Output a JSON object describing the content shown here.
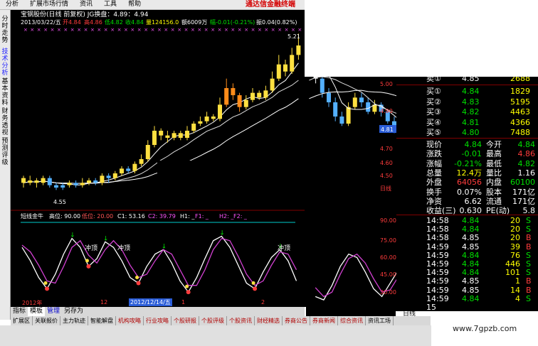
{
  "menu": [
    "分析",
    "扩展市场行情",
    "资讯",
    "工具",
    "帮助"
  ],
  "brand": "通达信金融终端",
  "left_tabs": [
    {
      "label": "分时走势",
      "active": false
    },
    {
      "label": "技术分析",
      "active": true
    },
    {
      "label": "基本资料",
      "active": false
    },
    {
      "label": "财务透视",
      "active": false
    },
    {
      "label": "预测评级",
      "active": false
    }
  ],
  "chart_header": {
    "line1": "宝钢股份(日线 前复权) JG换盘：4.89：4.94",
    "date": "2013/03/22/五",
    "open": "开4.84",
    "high": "高4.86",
    "low": "低4.82",
    "close": "收4.84",
    "vol": "量124156.0",
    "amount": "额6009万",
    "change": "幅-0.01(-0.21%)",
    "amp": "振0.04(0.82%)"
  },
  "main_labels": {
    "max": "5.21",
    "min": "4.55",
    "current": "4.81",
    "price_axis": [
      "5.00",
      "4.90",
      "4.80",
      "4.70",
      "4.60",
      "4.50"
    ],
    "day_label": "日线"
  },
  "chart_data": [
    {
      "type": "candlestick",
      "title": "宝钢股份(日线 前复权)",
      "y_axis_labels": [
        "5.00",
        "4.90",
        "4.80",
        "4.70",
        "4.60",
        "4.50"
      ],
      "annotations": [
        "5.21",
        "4.55",
        "4.81"
      ],
      "candles": [
        {
          "o": 4.6,
          "c": 4.58,
          "h": 4.61,
          "l": 4.56,
          "col": "y"
        },
        {
          "o": 4.58,
          "c": 4.59,
          "h": 4.61,
          "l": 4.57,
          "col": "y"
        },
        {
          "o": 4.59,
          "c": 4.58,
          "h": 4.6,
          "l": 4.56,
          "col": "y"
        },
        {
          "o": 4.58,
          "c": 4.6,
          "h": 4.61,
          "l": 4.57,
          "col": "y"
        },
        {
          "o": 4.6,
          "c": 4.57,
          "h": 4.61,
          "l": 4.56,
          "col": "b"
        },
        {
          "o": 4.57,
          "c": 4.56,
          "h": 4.58,
          "l": 4.55,
          "col": "b"
        },
        {
          "o": 4.56,
          "c": 4.57,
          "h": 4.58,
          "l": 4.55,
          "col": "b"
        },
        {
          "o": 4.57,
          "c": 4.58,
          "h": 4.59,
          "l": 4.56,
          "col": "y"
        },
        {
          "o": 4.58,
          "c": 4.57,
          "h": 4.59,
          "l": 4.56,
          "col": "b"
        },
        {
          "o": 4.57,
          "c": 4.58,
          "h": 4.6,
          "l": 4.56,
          "col": "y"
        },
        {
          "o": 4.58,
          "c": 4.59,
          "h": 4.6,
          "l": 4.57,
          "col": "y"
        },
        {
          "o": 4.59,
          "c": 4.58,
          "h": 4.6,
          "l": 4.57,
          "col": "b"
        },
        {
          "o": 4.58,
          "c": 4.61,
          "h": 4.62,
          "l": 4.57,
          "col": "y"
        },
        {
          "o": 4.61,
          "c": 4.6,
          "h": 4.62,
          "l": 4.58,
          "col": "b"
        },
        {
          "o": 4.6,
          "c": 4.62,
          "h": 4.63,
          "l": 4.59,
          "col": "y"
        },
        {
          "o": 4.62,
          "c": 4.64,
          "h": 4.65,
          "l": 4.61,
          "col": "y"
        },
        {
          "o": 4.64,
          "c": 4.63,
          "h": 4.65,
          "l": 4.62,
          "col": "b"
        },
        {
          "o": 4.63,
          "c": 4.66,
          "h": 4.67,
          "l": 4.62,
          "col": "y"
        },
        {
          "o": 4.66,
          "c": 4.68,
          "h": 4.7,
          "l": 4.65,
          "col": "y"
        },
        {
          "o": 4.68,
          "c": 4.74,
          "h": 4.76,
          "l": 4.67,
          "col": "y"
        },
        {
          "o": 4.74,
          "c": 4.8,
          "h": 4.82,
          "l": 4.73,
          "col": "y"
        },
        {
          "o": 4.8,
          "c": 4.78,
          "h": 4.81,
          "l": 4.76,
          "col": "y"
        },
        {
          "o": 4.78,
          "c": 4.77,
          "h": 4.8,
          "l": 4.75,
          "col": "y"
        },
        {
          "o": 4.77,
          "c": 4.79,
          "h": 4.8,
          "l": 4.76,
          "col": "y"
        },
        {
          "o": 4.79,
          "c": 4.77,
          "h": 4.8,
          "l": 4.76,
          "col": "y"
        },
        {
          "o": 4.77,
          "c": 4.8,
          "h": 4.82,
          "l": 4.76,
          "col": "y"
        },
        {
          "o": 4.8,
          "c": 4.83,
          "h": 4.84,
          "l": 4.79,
          "col": "y"
        },
        {
          "o": 4.83,
          "c": 4.84,
          "h": 4.86,
          "l": 4.82,
          "col": "y"
        },
        {
          "o": 4.84,
          "c": 4.86,
          "h": 4.88,
          "l": 4.83,
          "col": "y"
        },
        {
          "o": 4.86,
          "c": 4.85,
          "h": 4.87,
          "l": 4.84,
          "col": "y"
        },
        {
          "o": 4.85,
          "c": 4.91,
          "h": 4.94,
          "l": 4.84,
          "col": "y"
        },
        {
          "o": 4.91,
          "c": 4.98,
          "h": 5.02,
          "l": 4.9,
          "col": "o"
        },
        {
          "o": 4.98,
          "c": 4.95,
          "h": 5.0,
          "l": 4.93,
          "col": "o"
        },
        {
          "o": 4.95,
          "c": 4.9,
          "h": 4.96,
          "l": 4.88,
          "col": "o"
        },
        {
          "o": 4.9,
          "c": 4.93,
          "h": 4.95,
          "l": 4.89,
          "col": "y"
        },
        {
          "o": 4.93,
          "c": 4.96,
          "h": 4.98,
          "l": 4.92,
          "col": "y"
        },
        {
          "o": 4.96,
          "c": 4.94,
          "h": 4.97,
          "l": 4.93,
          "col": "y"
        },
        {
          "o": 4.94,
          "c": 4.97,
          "h": 4.99,
          "l": 4.93,
          "col": "y"
        },
        {
          "o": 4.97,
          "c": 5.02,
          "h": 5.05,
          "l": 4.96,
          "col": "y"
        },
        {
          "o": 5.02,
          "c": 5.08,
          "h": 5.12,
          "l": 5.01,
          "col": "y"
        },
        {
          "o": 5.08,
          "c": 5.05,
          "h": 5.1,
          "l": 5.03,
          "col": "y"
        },
        {
          "o": 5.05,
          "c": 5.12,
          "h": 5.15,
          "l": 5.04,
          "col": "y"
        },
        {
          "o": 5.12,
          "c": 5.16,
          "h": 5.21,
          "l": 5.1,
          "col": "y"
        },
        {
          "o": 5.16,
          "c": 5.02,
          "h": 5.17,
          "l": 5.0,
          "col": "w"
        },
        {
          "o": 5.02,
          "c": 4.96,
          "h": 5.03,
          "l": 4.94,
          "col": "b"
        },
        {
          "o": 4.96,
          "c": 4.92,
          "h": 4.98,
          "l": 4.9,
          "col": "b"
        },
        {
          "o": 4.92,
          "c": 4.86,
          "h": 4.94,
          "l": 4.84,
          "col": "b"
        },
        {
          "o": 4.86,
          "c": 4.83,
          "h": 4.88,
          "l": 4.82,
          "col": "b"
        },
        {
          "o": 4.83,
          "c": 4.9,
          "h": 4.92,
          "l": 4.82,
          "col": "y"
        },
        {
          "o": 4.9,
          "c": 4.94,
          "h": 4.96,
          "l": 4.89,
          "col": "y"
        },
        {
          "o": 4.94,
          "c": 4.92,
          "h": 4.96,
          "l": 4.9,
          "col": "b"
        },
        {
          "o": 4.92,
          "c": 4.88,
          "h": 4.94,
          "l": 4.87,
          "col": "b"
        },
        {
          "o": 4.88,
          "c": 4.91,
          "h": 4.93,
          "l": 4.87,
          "col": "y"
        },
        {
          "o": 4.91,
          "c": 4.88,
          "h": 4.92,
          "l": 4.86,
          "col": "b"
        },
        {
          "o": 4.88,
          "c": 4.84,
          "h": 4.89,
          "l": 4.83,
          "col": "b"
        },
        {
          "o": 4.84,
          "c": 4.81,
          "h": 4.86,
          "l": 4.79,
          "col": "b"
        },
        {
          "o": 4.81,
          "c": 4.76,
          "h": 4.82,
          "l": 4.74,
          "col": "b"
        },
        {
          "o": 4.76,
          "c": 4.78,
          "h": 4.8,
          "l": 4.74,
          "col": "b"
        },
        {
          "o": 4.78,
          "c": 4.8,
          "h": 4.82,
          "l": 4.77,
          "col": "b"
        },
        {
          "o": 4.8,
          "c": 4.81,
          "h": 4.83,
          "l": 4.79,
          "col": "b"
        }
      ]
    },
    {
      "type": "line",
      "title": "短线金牛",
      "legend": [
        "高位: 90.00",
        "低位: 20.00",
        "C1: 53.16",
        "C2: 39.79",
        "H1:",
        "F1:",
        "H2:",
        "F2:"
      ],
      "y_axis_labels": [
        "90.00",
        "75.00",
        "60.00",
        "45.00",
        "30.00"
      ],
      "ylim": [
        20,
        95
      ],
      "series": [
        {
          "name": "C1",
          "values": [
            72,
            60,
            45,
            35,
            48,
            66,
            80,
            72,
            55,
            62,
            77,
            72,
            60,
            45,
            40,
            55,
            66,
            70,
            58,
            42,
            32,
            45,
            62,
            78,
            82,
            72,
            56,
            40,
            35,
            50,
            63,
            70,
            60,
            42,
            28,
            25,
            38,
            55,
            66,
            63,
            50,
            35,
            28,
            40,
            52
          ]
        },
        {
          "name": "C2",
          "values": [
            74,
            68,
            56,
            42,
            40,
            55,
            72,
            78,
            65,
            58,
            70,
            78,
            70,
            56,
            45,
            48,
            60,
            70,
            66,
            52,
            38,
            38,
            52,
            70,
            80,
            78,
            64,
            48,
            38,
            42,
            56,
            68,
            66,
            52,
            36,
            28,
            32,
            48,
            62,
            66,
            58,
            44,
            32,
            34,
            46
          ]
        }
      ]
    }
  ],
  "sub_header": {
    "name": "短线金牛",
    "gao": "高位: 90.00",
    "di": "低位: 20.00",
    "c1": "C1: 53.16",
    "c2": "C2: 39.79",
    "h1": "H1: _",
    "f1": "F1: _",
    "h2": "H2: _",
    "f2": "F2: _"
  },
  "sub_labels": [
    "冲顶",
    "冲顶",
    "冲顶"
  ],
  "sub_axis": [
    "90.00",
    "75.00",
    "60.00",
    "45.00",
    "30.00"
  ],
  "time_axis": {
    "y2012": "2012年",
    "m12": "12",
    "date_box": "2012/12/14/五",
    "m1": "1",
    "m2": "2",
    "m3": "3"
  },
  "chart_tabs": [
    "指标",
    "模板",
    "管理",
    "另存为"
  ],
  "bottom_tabs": [
    "扩展区",
    "关联报价",
    "主力轨迹",
    "智能解盘",
    "机构攻略",
    "行业攻略",
    "个股研报",
    "个股评级",
    "个股资讯",
    "财经精选",
    "券商公告",
    "券商新闻",
    "综合资讯",
    "资讯工场"
  ],
  "right_axis_label": "日线",
  "quote": {
    "sell_partial": {
      "label": "卖①",
      "price": "4.85",
      "vol": "2688"
    },
    "buys": [
      {
        "label": "买①",
        "price": "4.84",
        "vol": "1829"
      },
      {
        "label": "买②",
        "price": "4.83",
        "vol": "5195"
      },
      {
        "label": "买③",
        "price": "4.82",
        "vol": "4463"
      },
      {
        "label": "买④",
        "price": "4.81",
        "vol": "4366"
      },
      {
        "label": "买⑤",
        "price": "4.80",
        "vol": "7488"
      }
    ],
    "stats": [
      {
        "l1": "现价",
        "v1": "4.84",
        "c1": "green",
        "l2": "今开",
        "v2": "4.84",
        "c2": "green"
      },
      {
        "l1": "涨跌",
        "v1": "-0.01",
        "c1": "green",
        "l2": "最高",
        "v2": "4.86",
        "c2": "red"
      },
      {
        "l1": "涨幅",
        "v1": "-0.21%",
        "c1": "green",
        "l2": "最低",
        "v2": "4.82",
        "c2": "green"
      },
      {
        "l1": "总量",
        "v1": "12.4万",
        "c1": "yellow",
        "l2": "量比",
        "v2": "1.16",
        "c2": "white"
      },
      {
        "l1": "外盘",
        "v1": "64056",
        "c1": "red",
        "l2": "内盘",
        "v2": "60100",
        "c2": "green"
      },
      {
        "l1": "换手",
        "v1": "0.07%",
        "c1": "white",
        "l2": "股本",
        "v2": "171亿",
        "c2": "white"
      },
      {
        "l1": "净资",
        "v1": "6.62",
        "c1": "white",
        "l2": "流通",
        "v2": "171亿",
        "c2": "white"
      },
      {
        "l1": "收益(三)",
        "v1": "0.630",
        "c1": "white",
        "l2": "PE(动)",
        "v2": "5.8",
        "c2": "white"
      }
    ],
    "ticks": [
      {
        "t": "14:58",
        "p": "4.84",
        "pc": "green",
        "v": "20",
        "d": "S",
        "dc": "green"
      },
      {
        "t": "14:58",
        "p": "4.84",
        "pc": "green",
        "v": "20",
        "d": "S",
        "dc": "green"
      },
      {
        "t": "14:58",
        "p": "4.85",
        "pc": "white",
        "v": "20",
        "d": "B",
        "dc": "red"
      },
      {
        "t": "14:59",
        "p": "4.85",
        "pc": "white",
        "v": "39",
        "d": "B",
        "dc": "red"
      },
      {
        "t": "14:59",
        "p": "4.84",
        "pc": "green",
        "v": "76",
        "d": "S",
        "dc": "green"
      },
      {
        "t": "14:59",
        "p": "4.84",
        "pc": "green",
        "v": "446",
        "d": "S",
        "dc": "green"
      },
      {
        "t": "14:59",
        "p": "4.84",
        "pc": "green",
        "v": "101",
        "d": "S",
        "dc": "green"
      },
      {
        "t": "14:59",
        "p": "4.85",
        "pc": "white",
        "v": "1",
        "d": "B",
        "dc": "red"
      },
      {
        "t": "14:59",
        "p": "4.85",
        "pc": "white",
        "v": "14",
        "d": "B",
        "dc": "red"
      },
      {
        "t": "14:59",
        "p": "4.84",
        "pc": "green",
        "v": "4",
        "d": "S",
        "dc": "green"
      },
      {
        "t": "15",
        "p": "",
        "pc": "white",
        "v": "",
        "d": "",
        "dc": "white"
      }
    ]
  },
  "watermark": "www.7gpzb.com",
  "colors": {
    "up": "#ff3c3c",
    "down": "#54b0ff",
    "yellow": "#ffe040",
    "orange": "#ff8c1a",
    "bg": "#000000"
  }
}
